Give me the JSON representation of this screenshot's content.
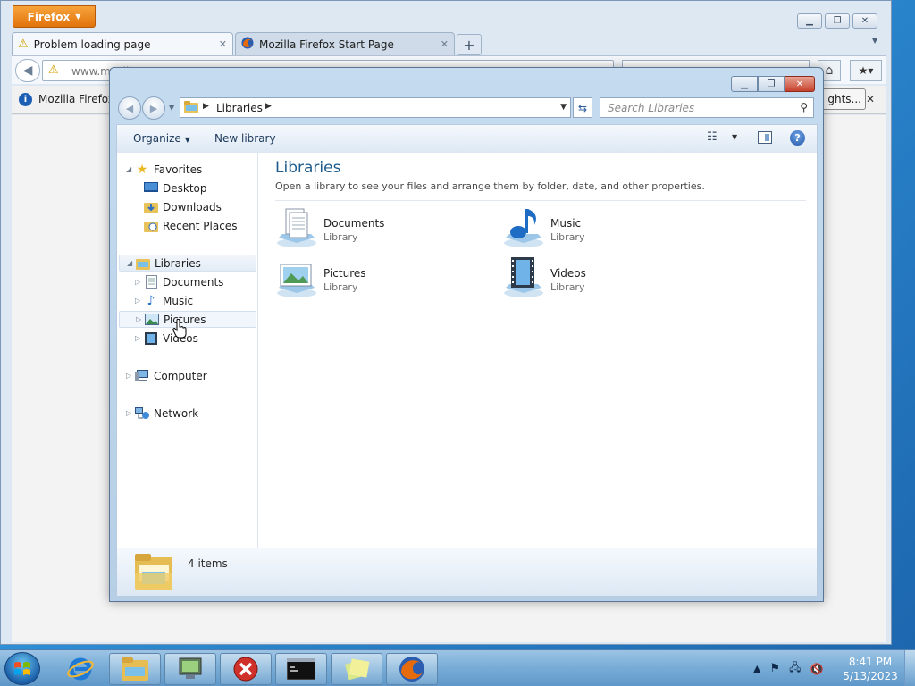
{
  "firefox": {
    "menu_label": "Firefox",
    "tabs": [
      {
        "label": "Problem loading page"
      },
      {
        "label": "Mozilla Firefox Start Page"
      }
    ],
    "url_text": "www.mozilla...",
    "notification_text": "Mozilla Firefox",
    "notification_button": "ghts..."
  },
  "explorer": {
    "address": {
      "segment": "Libraries"
    },
    "search_placeholder": "Search Libraries",
    "commands": {
      "organize": "Organize",
      "new_library": "New library"
    },
    "nav": {
      "favorites": {
        "label": "Favorites",
        "children": [
          "Desktop",
          "Downloads",
          "Recent Places"
        ]
      },
      "libraries": {
        "label": "Libraries",
        "children": [
          "Documents",
          "Music",
          "Pictures",
          "Videos"
        ]
      },
      "computer": "Computer",
      "network": "Network"
    },
    "content": {
      "title": "Libraries",
      "subtitle": "Open a library to see your files and arrange them by folder, date, and other properties.",
      "items": [
        {
          "name": "Documents",
          "type": "Library"
        },
        {
          "name": "Music",
          "type": "Library"
        },
        {
          "name": "Pictures",
          "type": "Library"
        },
        {
          "name": "Videos",
          "type": "Library"
        }
      ]
    },
    "status": {
      "count": "4 items"
    }
  },
  "taskbar": {
    "clock_time": "8:41 PM",
    "clock_date": "5/13/2023"
  },
  "colors": {
    "title_blue": "#1e5b8c",
    "firefox_orange": "#e2730c",
    "close_red": "#c6422c"
  }
}
